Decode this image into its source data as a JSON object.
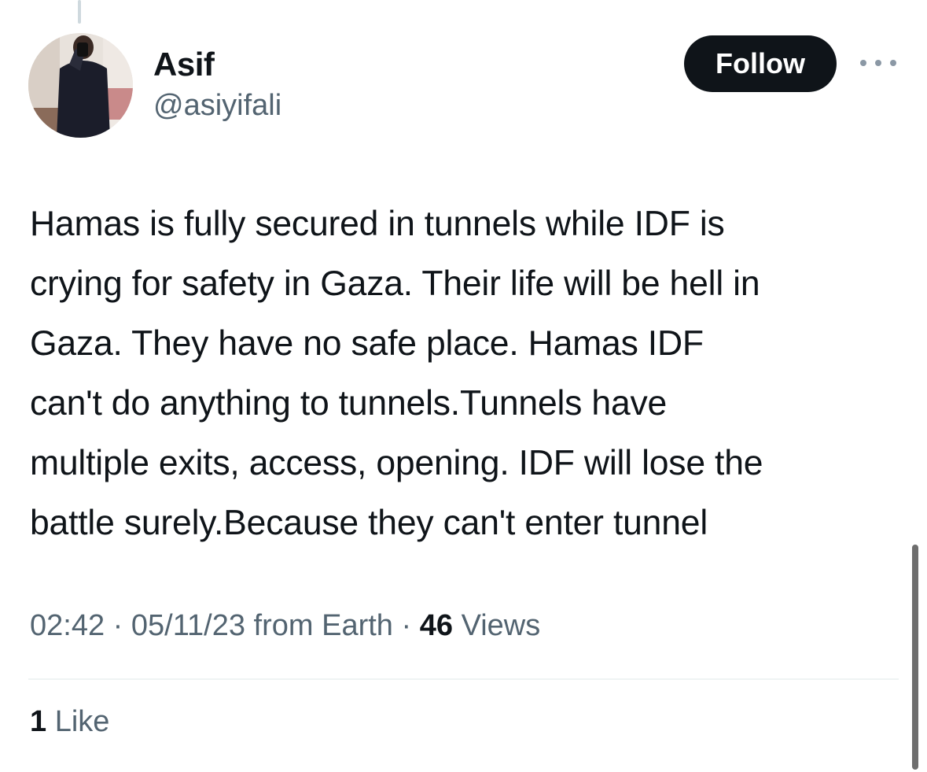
{
  "author": {
    "name": "Asif",
    "handle": "@asiyifali"
  },
  "follow_label": "Follow",
  "tweet": {
    "text": "Hamas is fully secured in tunnels while IDF is\ncrying for safety in Gaza. Their life will be hell in\nGaza. They have no safe place. Hamas IDF\ncan't do anything to tunnels.Tunnels have\nmultiple exits, access, opening. IDF will lose the\nbattle surely.Because they can't enter tunnel",
    "time": "02:42",
    "date": "05/11/23",
    "source": "from Earth",
    "separator": "·",
    "views_count": "46",
    "views_label": "Views",
    "likes_count": "1",
    "likes_label": "Like"
  },
  "icons": {
    "more": "more-horizontal-icon"
  },
  "colors": {
    "text_primary": "#0f1419",
    "text_secondary": "#536471",
    "follow_bg": "#0f1419",
    "divider": "#eff3f4"
  }
}
